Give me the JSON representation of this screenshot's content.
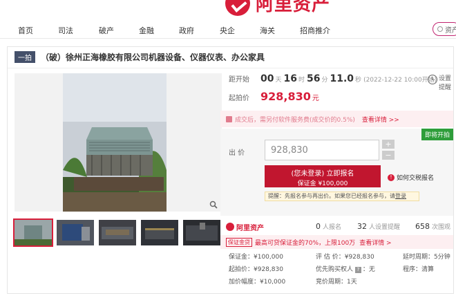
{
  "nav": {
    "items": [
      "首页",
      "司法",
      "破产",
      "金融",
      "政府",
      "央企",
      "海关",
      "招商推介"
    ],
    "search_text": "资产"
  },
  "brand": {
    "logo_text": "阿里资产",
    "accent": "#d81e3a"
  },
  "lot": {
    "tag": "一拍",
    "title": "（破）徐州正海橡胶有限公司机器设备、仪器仪表、办公家具"
  },
  "countdown": {
    "label": "距开始",
    "days": "00",
    "days_unit": "天",
    "hours": "16",
    "hours_unit": "时",
    "minutes": "56",
    "minutes_unit": "分",
    "seconds": "11.0",
    "seconds_unit": "秒",
    "start_note": "(2022-12-22 10:00开始)"
  },
  "settings": {
    "line1": "设置",
    "line2": "提醒"
  },
  "start_price": {
    "label": "起拍价",
    "value": "928,830",
    "unit": "元"
  },
  "notice": {
    "text": "成交后，需另付软件服务费(成交价的0.5%)",
    "link": "查看详情 >>"
  },
  "bid": {
    "badge": "即将开拍",
    "label": "出 价",
    "value": "928,830",
    "plus": "+",
    "minus": "−",
    "signup_line1": "(您未登录) 立即报名",
    "signup_line2": "保证金 ¥100,000",
    "help": "如何交税报名",
    "hint_prefix": "提醒：先报名参与再出价。如果您已经报名参与，请",
    "hint_link": "登录"
  },
  "stats": {
    "brand": "阿里资产",
    "signups": "0",
    "signups_label": "人报名",
    "reminders": "32",
    "reminders_label": "人设置提醒",
    "views": "658",
    "views_label": "次围观"
  },
  "promo": {
    "tag": "保证金贷",
    "text": "最高可贷保证金的70%，上限100万",
    "link": "查看详情 >"
  },
  "info": {
    "deposit": "保证金：¥100,000",
    "start_price": "起拍价：¥928,830",
    "increment": "加价幅度：¥10,000",
    "valuation": "评 估 价：¥928,830",
    "priority_label": "优先购买权人",
    "priority_icon": "?",
    "priority_value": "：无",
    "period": "竞价周期：1天",
    "delay": "延时周期：5分钟",
    "procedure": "程序：清算"
  },
  "images": {
    "main_alt": "冷却塔设备照片",
    "thumb_count": 5
  }
}
